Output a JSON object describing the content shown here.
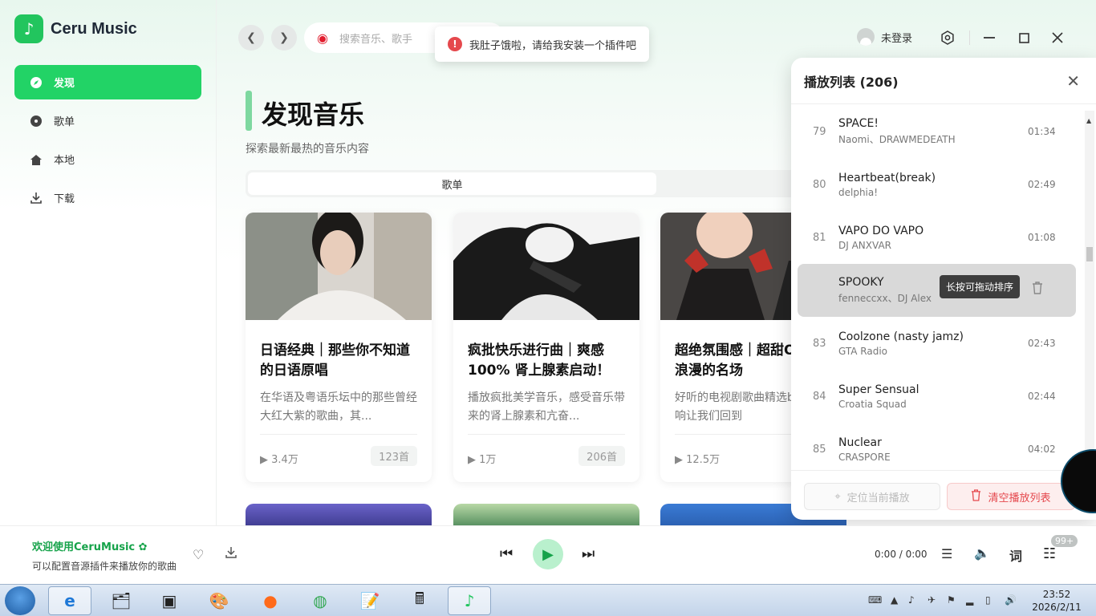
{
  "app": {
    "name": "Ceru Music"
  },
  "sidebar": {
    "items": [
      {
        "label": "发现",
        "icon": "compass-icon",
        "active": true
      },
      {
        "label": "歌单",
        "icon": "disc-icon",
        "active": false
      },
      {
        "label": "本地",
        "icon": "home-icon",
        "active": false
      },
      {
        "label": "下载",
        "icon": "download-icon",
        "active": false
      }
    ]
  },
  "header": {
    "search_placeholder": "搜索音乐、歌手",
    "toast": "我肚子饿啦，请给我安装一个插件吧",
    "user_label": "未登录"
  },
  "main": {
    "title": "发现音乐",
    "subtitle": "探索最新最热的音乐内容",
    "tab_label": "歌单",
    "cards": [
      {
        "title": "日语经典｜那些你不知道的日语原唱",
        "desc": "在华语及粤语乐坛中的那些曾经大红大紫的歌曲，其...",
        "plays": "3.4万",
        "count": "123首"
      },
      {
        "title": "疯批快乐进行曲｜爽感100% 肾上腺素启动！",
        "desc": "播放疯批美学音乐，感受音乐带来的肾上腺素和亢奋...",
        "plays": "1万",
        "count": "206首"
      },
      {
        "title": "超绝氛围感｜超甜OST｜浪漫的名场",
        "desc": "好听的电视剧歌曲精选bgm一响让我们回到",
        "plays": "12.5万",
        "count": ""
      }
    ]
  },
  "playlist": {
    "title": "播放列表 (206)",
    "tooltip": "长按可拖动排序",
    "locate_label": "定位当前播放",
    "clear_label": "清空播放列表",
    "songs": [
      {
        "num": "79",
        "name": "SPACE!",
        "artist": "Naomi、DRAWMEDEATH",
        "duration": "01:34"
      },
      {
        "num": "80",
        "name": "Heartbeat(break)",
        "artist": "delphia!",
        "duration": "02:49"
      },
      {
        "num": "81",
        "name": "VAPO DO VAPO",
        "artist": "DJ ANXVAR",
        "duration": "01:08"
      },
      {
        "num": "",
        "name": "SPOOKY",
        "artist": "fenneccxx、DJ Alex",
        "duration": ""
      },
      {
        "num": "83",
        "name": "Coolzone (nasty jamz)",
        "artist": "GTA Radio",
        "duration": "02:43"
      },
      {
        "num": "84",
        "name": "Super Sensual",
        "artist": "Croatia Squad",
        "duration": "02:44"
      },
      {
        "num": "85",
        "name": "Nuclear",
        "artist": "CRASPORE",
        "duration": "04:02"
      }
    ]
  },
  "player": {
    "welcome": "欢迎使用CeruMusic",
    "welcome_sub": "可以配置音源插件来播放你的歌曲",
    "time": "0:00 / 0:00",
    "badge": "99+",
    "lyric_label": "词"
  },
  "taskbar": {
    "time": "23:52",
    "date": "2026/2/11"
  },
  "colors": {
    "accent": "#22d366",
    "danger": "#e5484d"
  }
}
